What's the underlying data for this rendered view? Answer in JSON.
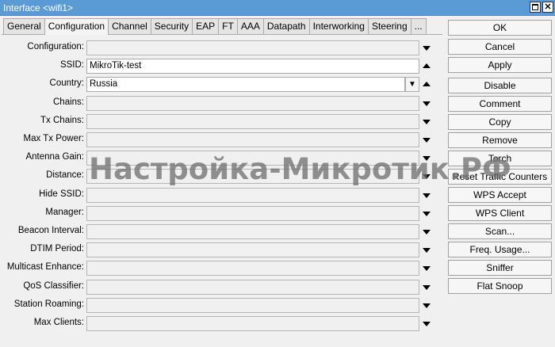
{
  "window": {
    "title": "Interface <wifi1>"
  },
  "tabs": [
    "General",
    "Configuration",
    "Channel",
    "Security",
    "EAP",
    "FT",
    "AAA",
    "Datapath",
    "Interworking",
    "Steering",
    "..."
  ],
  "active_tab": "Configuration",
  "fields": [
    {
      "label": "Configuration:",
      "value": "",
      "arrow": "down"
    },
    {
      "label": "SSID:",
      "value": "MikroTik-test",
      "arrow": "up"
    },
    {
      "label": "Country:",
      "value": "Russia",
      "arrow": "up",
      "dropdown": true
    },
    {
      "label": "Chains:",
      "value": "",
      "arrow": "down"
    },
    {
      "label": "Tx Chains:",
      "value": "",
      "arrow": "down"
    },
    {
      "label": "Max Tx Power:",
      "value": "",
      "arrow": "down"
    },
    {
      "label": "Antenna Gain:",
      "value": "",
      "arrow": "down"
    },
    {
      "label": "Distance:",
      "value": "",
      "arrow": "down"
    },
    {
      "label": "Hide SSID:",
      "value": "",
      "arrow": "down"
    },
    {
      "label": "Manager:",
      "value": "",
      "arrow": "down"
    },
    {
      "label": "Beacon Interval:",
      "value": "",
      "arrow": "down"
    },
    {
      "label": "DTIM Period:",
      "value": "",
      "arrow": "down"
    },
    {
      "label": "Multicast Enhance:",
      "value": "",
      "arrow": "down"
    },
    {
      "label": "QoS Classifier:",
      "value": "",
      "arrow": "down"
    },
    {
      "label": "Station Roaming:",
      "value": "",
      "arrow": "down"
    },
    {
      "label": "Max Clients:",
      "value": "",
      "arrow": "down"
    }
  ],
  "buttons": [
    "OK",
    "Cancel",
    "Apply",
    "Disable",
    "Comment",
    "Copy",
    "Remove",
    "Torch",
    "Reset Traffic Counters",
    "WPS Accept",
    "WPS Client",
    "Scan...",
    "Freq. Usage...",
    "Sniffer",
    "Flat Snoop"
  ],
  "watermark": "Настройка-Микротик.РФ",
  "colors": {
    "titlebar": "#5b9bd5",
    "background": "#f0f0f0"
  }
}
